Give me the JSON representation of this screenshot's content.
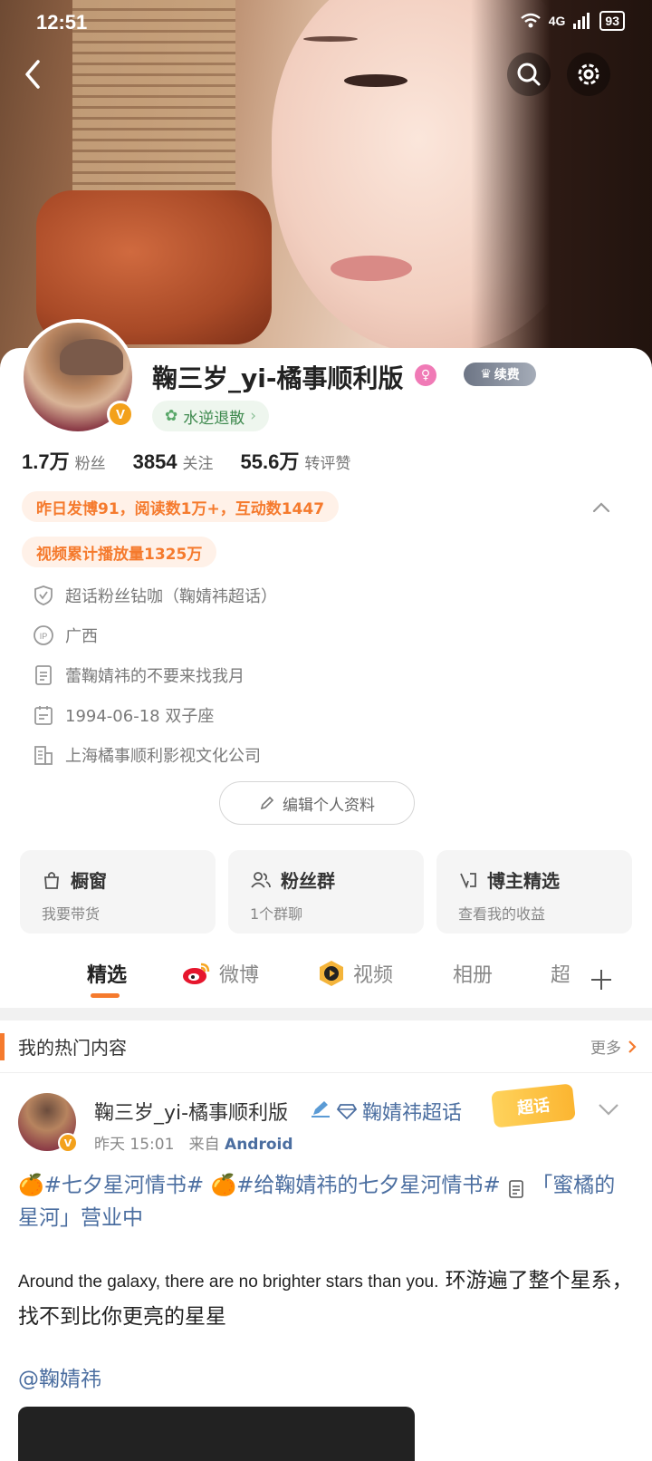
{
  "status_bar": {
    "time": "12:51",
    "network": "4G",
    "battery": "93"
  },
  "profile": {
    "username": "鞠三岁_yi-橘事顺利版",
    "verified_badge": "V",
    "renew_badge": "续费",
    "tag": "水逆退散",
    "stats": [
      {
        "value": "1.7万",
        "label": "粉丝"
      },
      {
        "value": "3854",
        "label": "关注"
      },
      {
        "value": "55.6万",
        "label": "转评赞"
      }
    ],
    "highlight_1": "昨日发博91，阅读数1万+，互动数1447",
    "highlight_2": "视频累计播放量1325万",
    "info": [
      {
        "icon": "shield-icon",
        "text": "超话粉丝钻咖（鞠婧祎超话）"
      },
      {
        "icon": "ip-icon",
        "text": "广西"
      },
      {
        "icon": "document-icon",
        "text": "蕾鞠婧祎的不要来找我月"
      },
      {
        "icon": "calendar-icon",
        "text": "1994-06-18 双子座"
      },
      {
        "icon": "building-icon",
        "text": "上海橘事顺利影视文化公司"
      }
    ],
    "edit_button": "编辑个人资料"
  },
  "tiles": [
    {
      "title": "橱窗",
      "subtitle": "我要带货",
      "icon": "shop-icon"
    },
    {
      "title": "粉丝群",
      "subtitle": "1个群聊",
      "icon": "group-icon"
    },
    {
      "title": "博主精选",
      "subtitle": "查看我的收益",
      "icon": "select-icon"
    }
  ],
  "tabs": [
    "精选",
    "微博",
    "视频",
    "相册",
    "超"
  ],
  "hot_section": {
    "title": "我的热门内容",
    "more": "更多"
  },
  "post": {
    "author": "鞠三岁_yi-橘事顺利版",
    "topic": "鞠婧祎超话",
    "chaohua_badge": "超话",
    "time": "昨天 15:01",
    "from_label": "来自",
    "source": "Android",
    "tags_line_a": "🍊#七夕星河情书# 🍊#给鞠婧祎的七夕星河情书# ",
    "tags_line_b": "「蜜橘的星河」营业中",
    "body_en_a": "Around the galaxy",
    "body_en_b": ", there are no brighter stars than you",
    "body_en_c": ".",
    "body_cn": " 环游遍了整个星系，找不到比你更亮的星星",
    "mention": "@鞠婧祎"
  },
  "colors": {
    "accent": "#f57a2d",
    "link": "#4b6ea0",
    "vip": "#f3a11b"
  }
}
